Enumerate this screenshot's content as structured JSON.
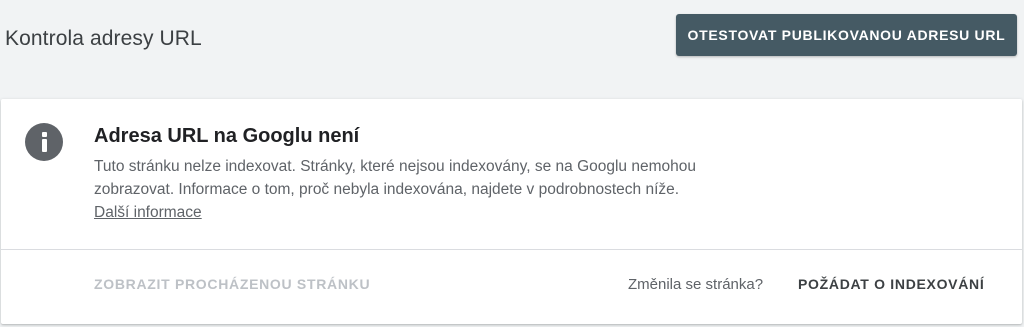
{
  "header": {
    "title": "Kontrola adresy URL",
    "test_live_label": "OTESTOVAT PUBLIKOVANOU ADRESU URL"
  },
  "card": {
    "icon": "info-icon",
    "title": "Adresa URL na Googlu není",
    "description": "Tuto stránku nelze indexovat. Stránky, které nejsou indexovány, se na Googlu nemohou zobrazovat. Informace o tom, proč nebyla indexována, najdete v podrobnostech níže.",
    "learn_more_label": "Další informace",
    "actions": {
      "view_crawled_label": "ZOBRAZIT PROCHÁZENOU STRÁNKU",
      "page_changed_text": "Změnila se stránka?",
      "request_indexing_label": "POŽÁDAT O INDEXOVÁNÍ"
    }
  },
  "colors": {
    "background": "#f1f3f4",
    "primary_button": "#455a64",
    "card": "#ffffff",
    "icon": "#5f6368"
  }
}
